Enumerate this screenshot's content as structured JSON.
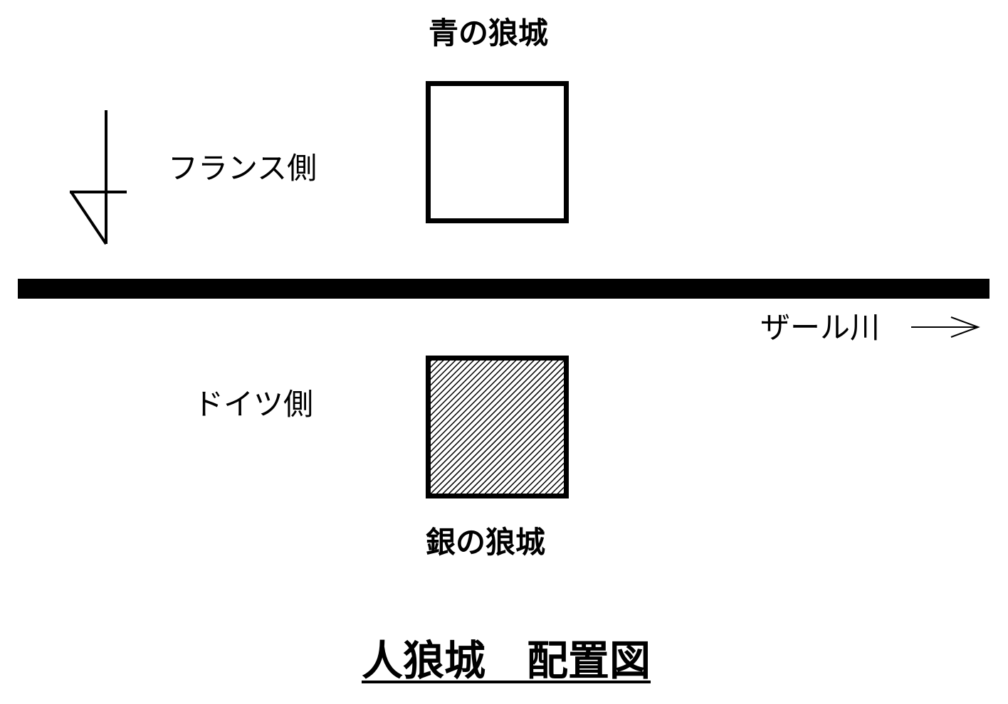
{
  "map": {
    "title": "人狼城　配置図",
    "north_marker": "north-arrow-icon",
    "castles": {
      "blue": {
        "label": "青の狼城",
        "fill": "white"
      },
      "silver": {
        "label": "銀の狼城",
        "fill": "hatched"
      }
    },
    "regions": {
      "france": "フランス側",
      "germany": "ドイツ側"
    },
    "river": {
      "label": "ザール川",
      "flow_arrow": "right-arrow-icon"
    },
    "colors": {
      "ink": "#000000",
      "paper": "#ffffff"
    }
  }
}
